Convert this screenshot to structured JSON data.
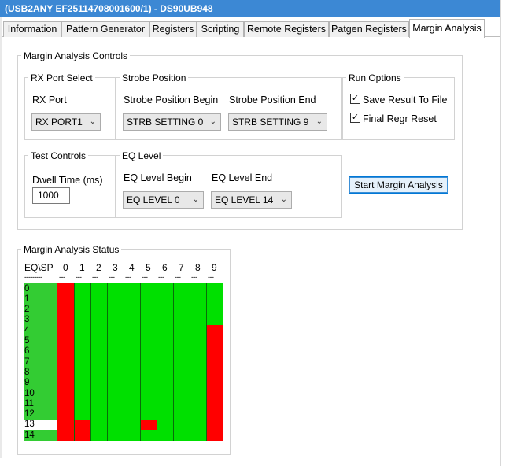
{
  "window": {
    "title": "(USB2ANY EF25114708001600/1) - DS90UB948"
  },
  "tabs": [
    {
      "label": "Information"
    },
    {
      "label": "Pattern Generator"
    },
    {
      "label": "Registers"
    },
    {
      "label": "Scripting"
    },
    {
      "label": "Remote Registers"
    },
    {
      "label": "Patgen Registers"
    },
    {
      "label": "Margin Analysis",
      "active": true
    }
  ],
  "controls": {
    "title": "Margin Analysis Controls",
    "rx_port_select": {
      "title": "RX Port Select",
      "label": "RX Port",
      "value": "RX PORT1"
    },
    "strobe_position": {
      "title": "Strobe Position",
      "begin_label": "Strobe Position Begin",
      "begin_value": "STRB SETTING 0",
      "end_label": "Strobe Position End",
      "end_value": "STRB SETTING 9"
    },
    "run_options": {
      "title": "Run Options",
      "save_result": {
        "label": "Save Result To File",
        "checked": true
      },
      "final_regr_reset": {
        "label": "Final Regr Reset",
        "checked": true
      }
    },
    "test_controls": {
      "title": "Test Controls",
      "dwell_label": "Dwell Time (ms)",
      "dwell_value": "1000"
    },
    "eq_level": {
      "title": "EQ Level",
      "begin_label": "EQ Level Begin",
      "begin_value": "EQ LEVEL 0",
      "end_label": "EQ Level End",
      "end_value": "EQ LEVEL 14"
    },
    "start_button": "Start Margin Analysis"
  },
  "status": {
    "title": "Margin Analysis Status",
    "corner_label": "EQ\\SP",
    "dashes": "---------",
    "sp_columns": [
      "0",
      "1",
      "2",
      "3",
      "4",
      "5",
      "6",
      "7",
      "8",
      "9"
    ],
    "eq_rows": [
      "0",
      "1",
      "2",
      "3",
      "4",
      "5",
      "6",
      "7",
      "8",
      "9",
      "10",
      "11",
      "12",
      "13",
      "14"
    ],
    "pass_color": "#00e000",
    "fail_color": "#ff0000",
    "label_column_color": "#33cc33",
    "result_grid": [
      [
        "F",
        "P",
        "P",
        "P",
        "P",
        "P",
        "P",
        "P",
        "P",
        "P"
      ],
      [
        "F",
        "P",
        "P",
        "P",
        "P",
        "P",
        "P",
        "P",
        "P",
        "P"
      ],
      [
        "F",
        "P",
        "P",
        "P",
        "P",
        "P",
        "P",
        "P",
        "P",
        "P"
      ],
      [
        "F",
        "P",
        "P",
        "P",
        "P",
        "P",
        "P",
        "P",
        "P",
        "P"
      ],
      [
        "F",
        "P",
        "P",
        "P",
        "P",
        "P",
        "P",
        "P",
        "P",
        "F"
      ],
      [
        "F",
        "P",
        "P",
        "P",
        "P",
        "P",
        "P",
        "P",
        "P",
        "F"
      ],
      [
        "F",
        "P",
        "P",
        "P",
        "P",
        "P",
        "P",
        "P",
        "P",
        "F"
      ],
      [
        "F",
        "P",
        "P",
        "P",
        "P",
        "P",
        "P",
        "P",
        "P",
        "F"
      ],
      [
        "F",
        "P",
        "P",
        "P",
        "P",
        "P",
        "P",
        "P",
        "P",
        "F"
      ],
      [
        "F",
        "P",
        "P",
        "P",
        "P",
        "P",
        "P",
        "P",
        "P",
        "F"
      ],
      [
        "F",
        "P",
        "P",
        "P",
        "P",
        "P",
        "P",
        "P",
        "P",
        "F"
      ],
      [
        "F",
        "P",
        "P",
        "P",
        "P",
        "P",
        "P",
        "P",
        "P",
        "F"
      ],
      [
        "F",
        "P",
        "P",
        "P",
        "P",
        "P",
        "P",
        "P",
        "P",
        "F"
      ],
      [
        "F",
        "F",
        "P",
        "P",
        "P",
        "F",
        "P",
        "P",
        "P",
        "F"
      ],
      [
        "F",
        "F",
        "P",
        "P",
        "P",
        "P",
        "P",
        "P",
        "P",
        "F"
      ]
    ]
  }
}
